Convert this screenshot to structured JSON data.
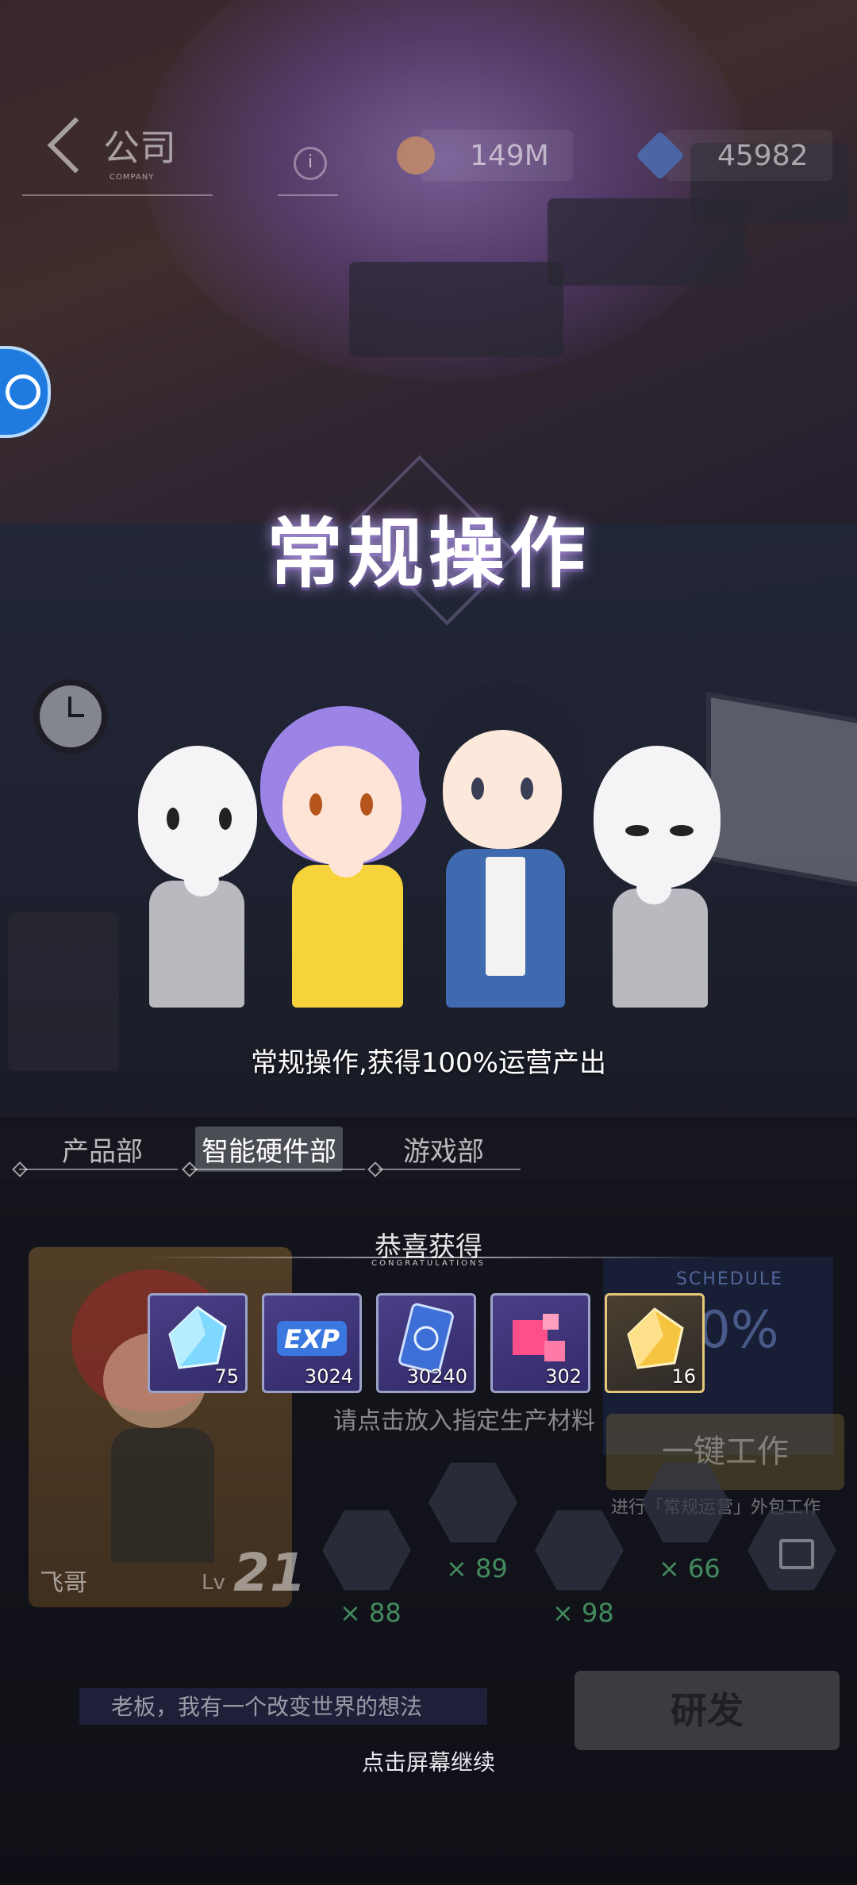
{
  "hud": {
    "company_label": "公司",
    "company_sub": "COMPANY",
    "coins": "149M",
    "gems": "45982"
  },
  "banner": {
    "title": "常规操作",
    "subtitle": "常规操作,获得100%运营产出"
  },
  "departments": {
    "tabs": [
      "产品部",
      "智能硬件部",
      "游戏部"
    ],
    "active_index": 1
  },
  "employee": {
    "name": "飞哥",
    "level_label": "Lv",
    "level": "21"
  },
  "research": {
    "schedule_label": "SCHEDULE",
    "schedule_value": "0%",
    "material_hint": "请点击放入指定生产材料",
    "one_key_button": "一键工作",
    "outsourcing_hint": "进行「常规运营」外包工作",
    "materials": [
      {
        "icon": "detective-icon",
        "count": "× 88"
      },
      {
        "icon": "puzzle-icon",
        "count": "× 89"
      },
      {
        "icon": "letter-a-icon",
        "count": "× 98"
      },
      {
        "icon": "fire-orb-icon",
        "count": "× 66"
      }
    ],
    "develop_button": "研发",
    "dialog_text": "老板，我有一个改变世界的想法"
  },
  "congrats": {
    "title": "恭喜获得",
    "subtitle": "CONGRATULATIONS",
    "rewards": [
      {
        "icon": "blue-crystal-icon",
        "quantity": "75",
        "color": "#7fd8ff"
      },
      {
        "icon": "exp-icon",
        "quantity": "3024",
        "color": "#3a78e0"
      },
      {
        "icon": "blue-card-icon",
        "quantity": "30240",
        "color": "#3d6fd6"
      },
      {
        "icon": "pink-cubes-icon",
        "quantity": "302",
        "color": "#ff4f8a"
      },
      {
        "icon": "gold-crystal-icon",
        "quantity": "16",
        "color": "#f5c542"
      }
    ]
  },
  "footer": {
    "tap_to_continue": "点击屏幕继续"
  }
}
